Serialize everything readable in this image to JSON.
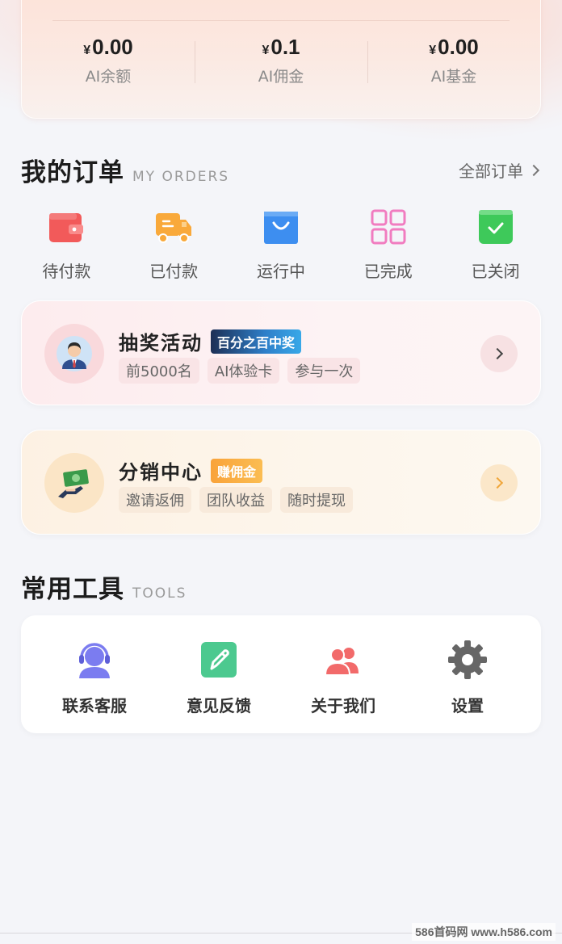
{
  "wallet": {
    "currency": "¥",
    "stats": [
      {
        "value": "0.00",
        "label": "AI余额"
      },
      {
        "value": "0.1",
        "label": "AI佣金"
      },
      {
        "value": "0.00",
        "label": "AI基金"
      }
    ]
  },
  "orders": {
    "title": "我的订单",
    "subtitle": "MY ORDERS",
    "all_label": "全部订单",
    "items": [
      {
        "label": "待付款",
        "icon": "wallet-icon"
      },
      {
        "label": "已付款",
        "icon": "truck-icon"
      },
      {
        "label": "运行中",
        "icon": "bag-icon"
      },
      {
        "label": "已完成",
        "icon": "grid-icon"
      },
      {
        "label": "已关闭",
        "icon": "check-box-icon"
      }
    ]
  },
  "lottery": {
    "title": "抽奖活动",
    "badge": "百分之百中奖",
    "tags": [
      "前5000名",
      "AI体验卡",
      "参与一次"
    ]
  },
  "distribution": {
    "title": "分销中心",
    "badge": "赚佣金",
    "tags": [
      "邀请返佣",
      "团队收益",
      "随时提现"
    ]
  },
  "tools": {
    "title": "常用工具",
    "subtitle": "TOOLS",
    "items": [
      {
        "label": "联系客服",
        "icon": "headset-icon"
      },
      {
        "label": "意见反馈",
        "icon": "feedback-icon"
      },
      {
        "label": "关于我们",
        "icon": "users-icon"
      },
      {
        "label": "设置",
        "icon": "gear-icon"
      }
    ]
  },
  "watermark": "586首码网 www.h586.com",
  "colors": {
    "red": "#f25a5a",
    "orange": "#f9a93b",
    "blue": "#3d8ef0",
    "pink": "#f17cc0",
    "green": "#3ec95a",
    "purple": "#7b7cf0"
  }
}
